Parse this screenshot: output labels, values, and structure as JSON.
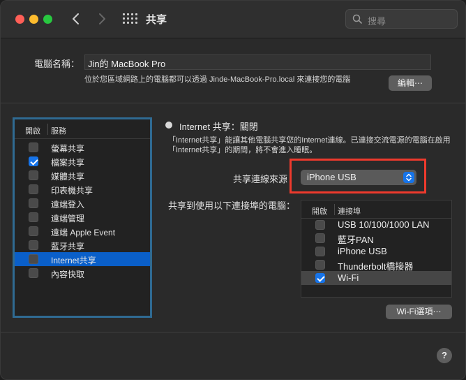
{
  "window": {
    "title": "共享"
  },
  "search": {
    "placeholder": "搜尋"
  },
  "computer_name": {
    "label": "電腦名稱：",
    "value": "Jin的 MacBook Pro",
    "description": "位於您區域網路上的電腦都可以透過 Jinde-MacBook-Pro.local 來連接您的電腦",
    "edit_button": "編輯⋯"
  },
  "services": {
    "header_on": "開啟",
    "header_service": "服務",
    "items": [
      {
        "label": "螢幕共享",
        "checked": false,
        "selected": false
      },
      {
        "label": "檔案共享",
        "checked": true,
        "selected": false
      },
      {
        "label": "媒體共享",
        "checked": false,
        "selected": false
      },
      {
        "label": "印表機共享",
        "checked": false,
        "selected": false
      },
      {
        "label": "遠端登入",
        "checked": false,
        "selected": false
      },
      {
        "label": "遠端管理",
        "checked": false,
        "selected": false
      },
      {
        "label": "遠端 Apple Event",
        "checked": false,
        "selected": false
      },
      {
        "label": "藍牙共享",
        "checked": false,
        "selected": false
      },
      {
        "label": "Internet共享",
        "checked": false,
        "selected": true
      },
      {
        "label": "內容快取",
        "checked": false,
        "selected": false
      }
    ]
  },
  "internet_sharing": {
    "status": "Internet 共享：關閉",
    "description": "「Internet共享」能讓其他電腦共享您的Internet連線。已連接交流電源的電腦在啟用「Internet共享」的期間，將不會進入睡眠。",
    "source_label": "共享連線來源",
    "source_value": "iPhone USB",
    "ports_label": "共享到使用以下連接埠的電腦：",
    "ports_header_on": "開啟",
    "ports_header_port": "連接埠",
    "ports": [
      {
        "label": "USB 10/100/1000 LAN",
        "checked": false,
        "selected": false
      },
      {
        "label": "藍牙PAN",
        "checked": false,
        "selected": false
      },
      {
        "label": "iPhone USB",
        "checked": false,
        "selected": false
      },
      {
        "label": "Thunderbolt橋接器",
        "checked": false,
        "selected": false
      },
      {
        "label": "Wi-Fi",
        "checked": true,
        "selected": true
      }
    ],
    "wifi_options_button": "Wi-Fi選項⋯"
  },
  "help": {
    "label": "?"
  },
  "colors": {
    "accent": "#1674ea",
    "selection": "#0a5fc9",
    "highlight_box": "#ee3a2d",
    "list_focus_border": "#2f6a92"
  }
}
